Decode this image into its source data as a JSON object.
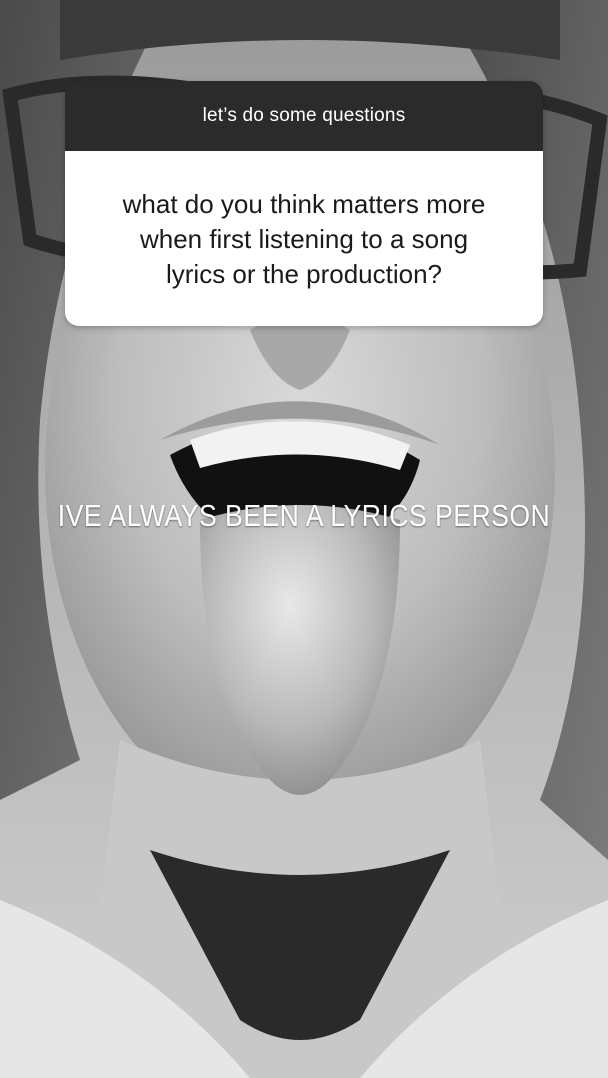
{
  "sticker": {
    "header": "let’s do some questions",
    "question_lines": [
      "what do you think matters more",
      "when first listening to a song",
      "lyrics or the production?"
    ]
  },
  "caption": "IVE ALWAYS BEEN A LYRICS PERSON",
  "colors": {
    "sticker_header_bg": "#2b2b2b",
    "sticker_body_bg": "#ffffff",
    "caption_text": "#ffffff"
  }
}
